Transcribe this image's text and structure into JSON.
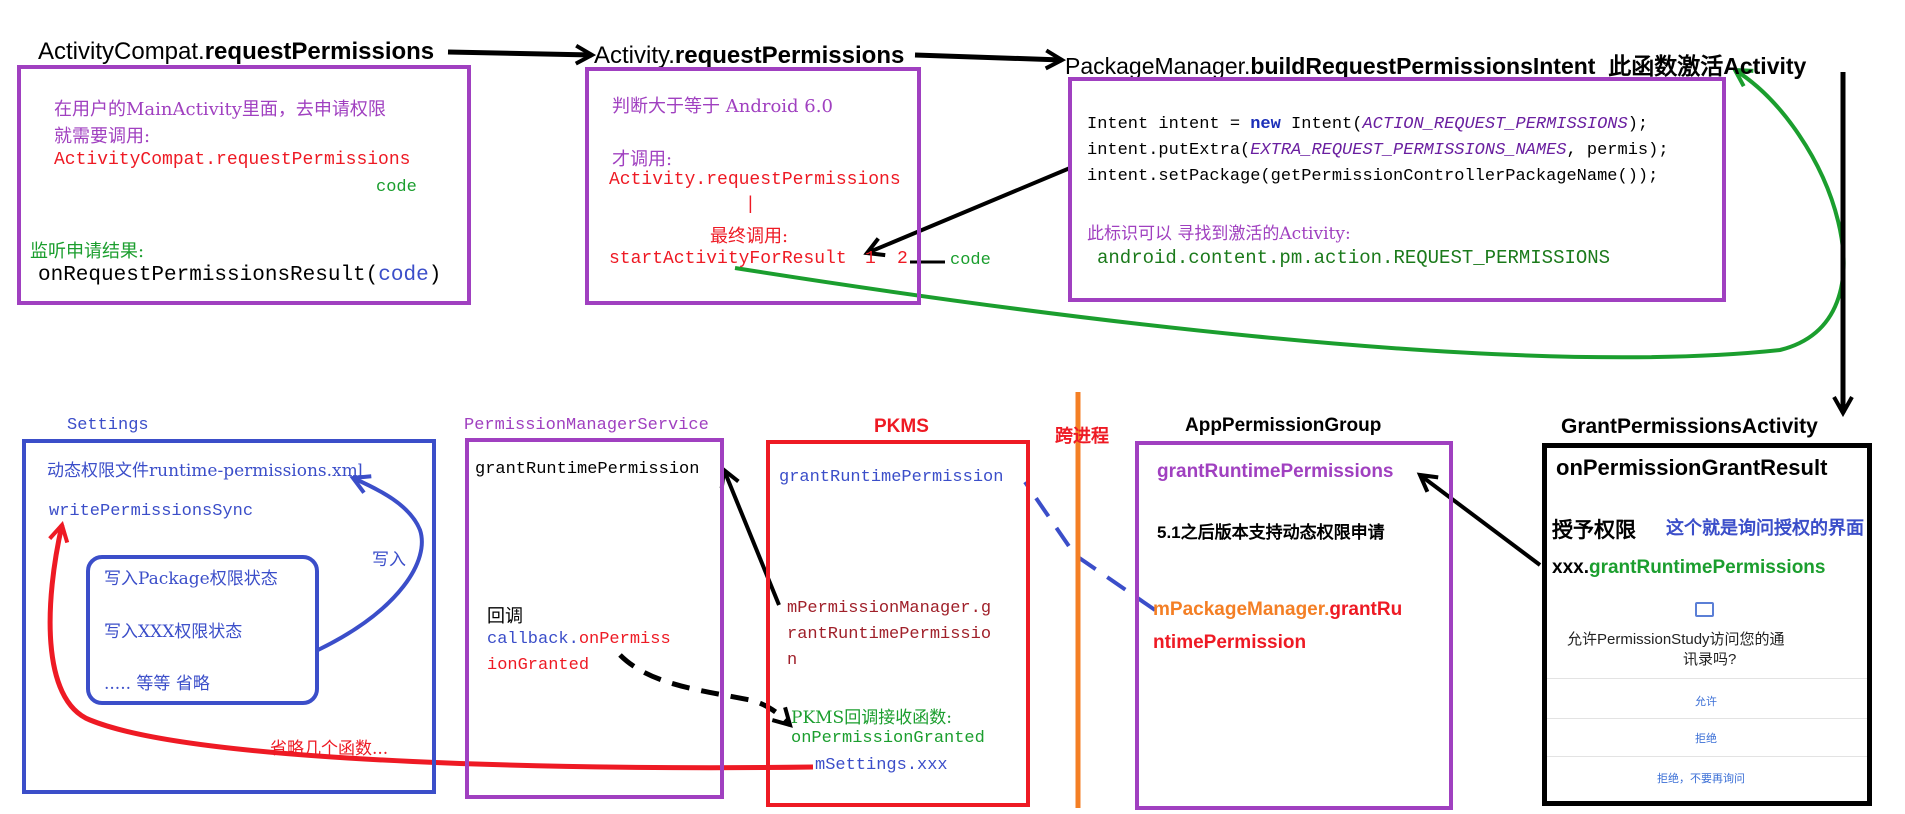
{
  "colors": {
    "purple": "#a040c0",
    "red": "#ee1a24",
    "blue": "#3b4ec9",
    "green": "#1b9e2e",
    "orange": "#f47f25",
    "black": "#000000"
  },
  "top_labels": {
    "ac_prefix": "ActivityCompat.",
    "ac_method": "requestPermissions",
    "act_prefix": "Activity.",
    "act_method": "requestPermissions",
    "pm_prefix": "PackageManager.",
    "pm_method": "buildRequestPermissionsIntent",
    "pm_note": "此函数激活Activity"
  },
  "box1": {
    "line1": "在用户的MainActivity里面，去申请权限",
    "line2": "就需要调用:",
    "line3": "ActivityCompat.requestPermissions",
    "line4": "code",
    "line5": "监听申请结果:",
    "line6a": "onRequestPermissionsResult(",
    "line6b": "code",
    "line6c": ")"
  },
  "box2": {
    "line1": "判断大于等于 Android 6.0",
    "line2": "才调用:",
    "line3": "Activity.requestPermissions",
    "line4": "|",
    "line5": "最终调用:",
    "line6": "startActivityForResult",
    "n1": "1",
    "n2": "2",
    "code": "code"
  },
  "box3": {
    "l1a": "Intent intent = ",
    "l1b": "new",
    "l1c": " Intent(",
    "l1d": "ACTION_REQUEST_PERMISSIONS",
    "l1e": ");",
    "l2a": "intent.putExtra(",
    "l2b": "EXTRA_REQUEST_PERMISSIONS_NAMES",
    "l2c": ", permis);",
    "l3": "intent.setPackage(getPermissionControllerPackageName());",
    "l4": "此标识可以 寻找到激活的Activity:",
    "l5": "android.content.pm.action.REQUEST_PERMISSIONS"
  },
  "settings": {
    "title": "Settings",
    "line1": "动态权限文件runtime-permissions.xml",
    "line2": "writePermissionsSync",
    "inner1": "写入Package权限状态",
    "inner2": "写入XXX权限状态",
    "inner3": "..... 等等 省略",
    "write_label": "写入",
    "omit_label": "省略几个函数..."
  },
  "pms": {
    "title": "PermissionManagerService",
    "line1": "grantRuntimePermission",
    "line2": "回调",
    "line3a": "callback.",
    "line3b": "onPermiss",
    "line4": "ionGranted"
  },
  "pkms": {
    "title": "PKMS",
    "line1": "grantRuntimePermission",
    "line2": "mPermissionManager.g",
    "line3": "rantRuntimePermissio",
    "line4": "n",
    "line5": "PKMS回调接收函数:",
    "line6": "onPermissionGranted",
    "line7": "mSettings.xxx"
  },
  "cross": {
    "label": "跨进程"
  },
  "apg": {
    "title": "AppPermissionGroup",
    "line1": "grantRuntimePermissions",
    "line2": "5.1之后版本支持动态权限申请",
    "line3a": "mPackageManager.",
    "line3b": "grantRu",
    "line4": "ntimePermission"
  },
  "gpa": {
    "title": "GrantPermissionsActivity",
    "line1": "onPermissionGrantResult",
    "line2": "授予权限",
    "note": "这个就是询问授权的界面",
    "line3a": "xxx.",
    "line3b": "grantRuntimePermissions",
    "dialog": {
      "icon": "contacts-icon",
      "message1": "允许PermissionStudy访问您的通",
      "message2": "讯录吗?",
      "allow": "允许",
      "deny": "拒绝",
      "deny_forever": "拒绝，不要再询问"
    }
  }
}
